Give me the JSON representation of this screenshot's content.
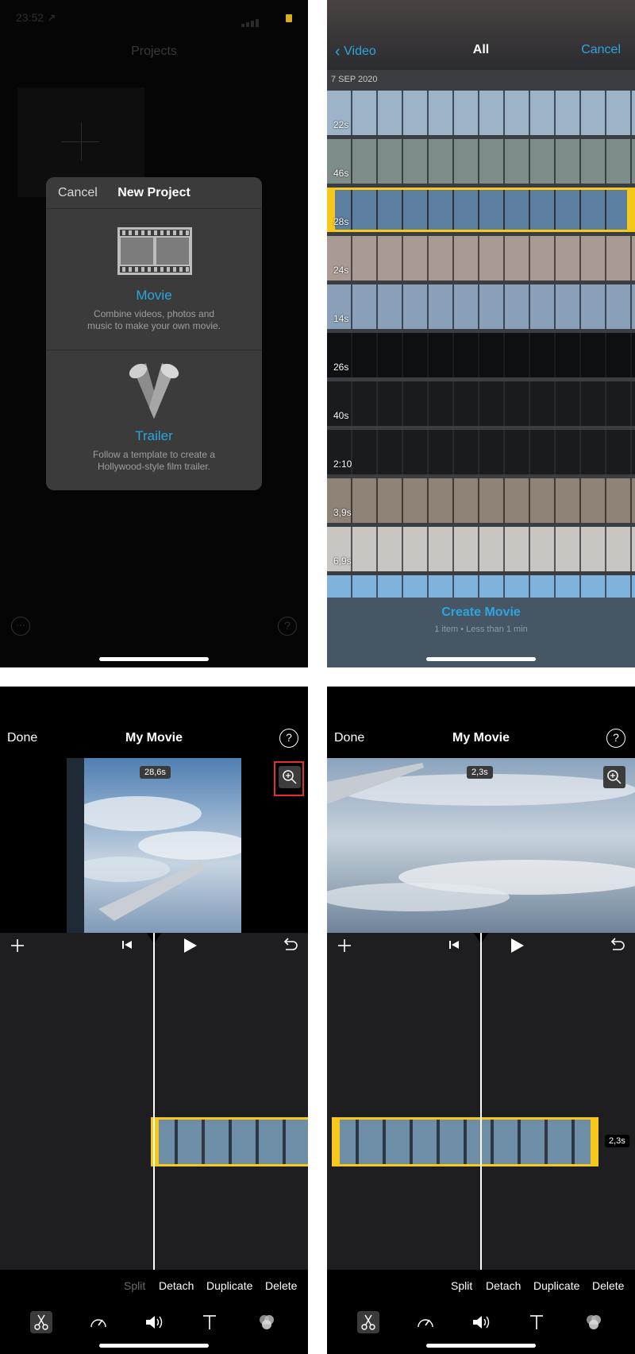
{
  "panel1": {
    "status_time": "23:52 ↗",
    "screen_title": "Projects",
    "more_label": "···",
    "help_label": "?",
    "dialog": {
      "cancel_label": "Cancel",
      "title": "New Project",
      "movie_label": "Movie",
      "movie_desc_1": "Combine videos, photos and",
      "movie_desc_2": "music to make your own movie.",
      "trailer_label": "Trailer",
      "trailer_desc_1": "Follow a template to create a",
      "trailer_desc_2": "Hollywood-style film trailer."
    }
  },
  "panel2": {
    "back_label": "Video",
    "title": "All",
    "cancel_label": "Cancel",
    "date": "7 SEP 2020",
    "clips": [
      {
        "duration": "22s",
        "style": "skybright"
      },
      {
        "duration": "46s",
        "style": "field"
      },
      {
        "duration": "28s",
        "style": "sky",
        "selected": true
      },
      {
        "duration": "24s",
        "style": "window"
      },
      {
        "duration": "14s",
        "style": "window2"
      },
      {
        "duration": "26s",
        "style": "dark"
      },
      {
        "duration": "40s",
        "style": "dark2"
      },
      {
        "duration": "2:10",
        "style": "dark2"
      },
      {
        "duration": "3,9s",
        "style": "crowd"
      },
      {
        "duration": "6,9s",
        "style": "planes"
      },
      {
        "duration": "",
        "style": "bluesky"
      }
    ],
    "create_label": "Create Movie",
    "create_info": "1 item • Less than 1 min"
  },
  "panel3": {
    "done_label": "Done",
    "title": "My Movie",
    "help_label": "?",
    "clip_duration": "28,6s",
    "actions": {
      "split": "Split",
      "detach": "Detach",
      "duplicate": "Duplicate",
      "delete": "Delete"
    },
    "split_disabled": true
  },
  "panel4": {
    "done_label": "Done",
    "title": "My Movie",
    "help_label": "?",
    "clip_duration": "2,3s",
    "timeline_duration": "2,3s",
    "actions": {
      "split": "Split",
      "detach": "Detach",
      "duplicate": "Duplicate",
      "delete": "Delete"
    }
  },
  "colors": {
    "accent": "#2ba6e0",
    "selection": "#f6c81c",
    "highlight_box": "#e03030"
  }
}
